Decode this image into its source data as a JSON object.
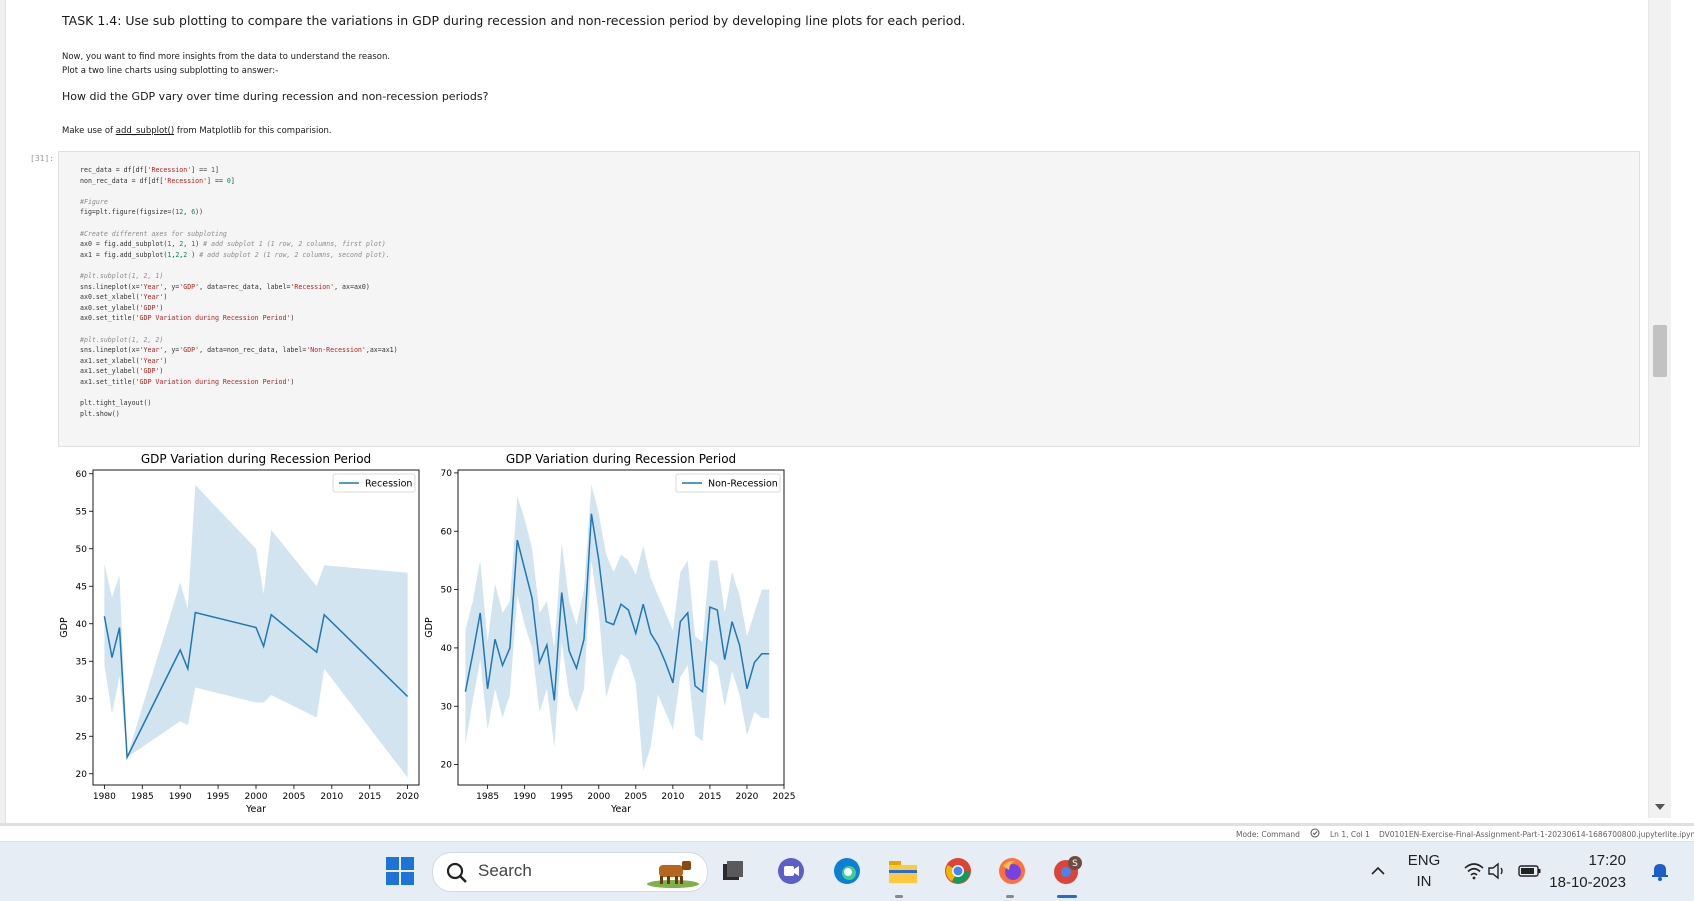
{
  "notebook": {
    "task_heading": "TASK 1.4: Use sub plotting to compare the variations in GDP during recession and non-recession period by developing line plots for each period.",
    "sub_text_1": "Now, you want to find more insights from the data to understand the reason.",
    "sub_text_2": "Plot a two line charts using subplotting to answer:-",
    "question": "How did the GDP vary over time during recession and non-recession periods?",
    "use_prefix": "Make use of ",
    "use_link": "add_subplot()",
    "use_suffix": " from Matplotlib for this comparision.",
    "cell_prompt": "[31]:",
    "code_lines": [
      "rec_data = df[df['Recession'] == 1]",
      "non_rec_data = df[df['Recession'] == 0]",
      "",
      "#Figure",
      "fig=plt.figure(figsize=(12, 6))",
      "",
      "#Create different axes for subploting",
      "ax0 = fig.add_subplot(1, 2, 1) # add subplot 1 (1 row, 2 columns, first plot)",
      "ax1 = fig.add_subplot(1,2,2 ) # add subplot 2 (1 row, 2 columns, second plot).",
      "",
      "#plt.subplot(1, 2, 1)",
      "sns.lineplot(x='Year', y='GDP', data=rec_data, label='Recession', ax=ax0)",
      "ax0.set_xlabel('Year')",
      "ax0.set_ylabel('GDP')",
      "ax0.set_title('GDP Variation during Recession Period')",
      "",
      "#plt.subplot(1, 2, 2)",
      "sns.lineplot(x='Year', y='GDP', data=non_rec_data, label='Non-Recession',ax=ax1)",
      "ax1.set_xlabel('Year')",
      "ax1.set_ylabel('GDP')",
      "ax1.set_title('GDP Variation during Recession Period')",
      "",
      "plt.tight_layout()",
      "plt.show()"
    ]
  },
  "chart_data": [
    {
      "type": "line",
      "title": "GDP Variation during Recession Period",
      "xlabel": "Year",
      "ylabel": "GDP",
      "xlim": [
        1978.5,
        2021.5
      ],
      "ylim": [
        18.5,
        60.5
      ],
      "xticks": [
        1980,
        1985,
        1990,
        1995,
        2000,
        2005,
        2010,
        2015,
        2020
      ],
      "yticks": [
        20,
        25,
        30,
        35,
        40,
        45,
        50,
        55,
        60
      ],
      "legend": "top-right",
      "series": [
        {
          "name": "Recession",
          "color": "#1f77b4",
          "x": [
            1980,
            1981,
            1982,
            1983,
            1990,
            1991,
            1992,
            2000,
            2001,
            2002,
            2008,
            2009,
            2020
          ],
          "y": [
            41.0,
            35.5,
            39.5,
            22.2,
            36.5,
            34.0,
            41.5,
            39.5,
            37.0,
            41.2,
            36.2,
            41.2,
            30.3
          ],
          "ci_low": [
            34.5,
            28.0,
            33.0,
            22.2,
            27.0,
            26.5,
            31.5,
            29.5,
            29.5,
            30.5,
            27.5,
            34.0,
            19.5
          ],
          "ci_high": [
            48.0,
            43.5,
            46.5,
            22.2,
            45.5,
            42.0,
            58.5,
            50.0,
            44.0,
            52.5,
            45.0,
            47.8,
            46.8
          ]
        }
      ]
    },
    {
      "type": "line",
      "title": "GDP Variation during Recession Period",
      "xlabel": "Year",
      "ylabel": "GDP",
      "xlim": [
        1981,
        2025
      ],
      "ylim": [
        16.5,
        70.5
      ],
      "xticks": [
        1985,
        1990,
        1995,
        2000,
        2005,
        2010,
        2015,
        2020,
        2025
      ],
      "yticks": [
        20,
        30,
        40,
        50,
        60,
        70
      ],
      "legend": "top-right",
      "series": [
        {
          "name": "Non-Recession",
          "color": "#1f77b4",
          "x": [
            1982,
            1983,
            1984,
            1985,
            1986,
            1987,
            1988,
            1989,
            1990,
            1991,
            1992,
            1993,
            1994,
            1995,
            1996,
            1997,
            1998,
            1999,
            2000,
            2001,
            2002,
            2003,
            2004,
            2005,
            2006,
            2007,
            2008,
            2009,
            2010,
            2011,
            2012,
            2013,
            2014,
            2015,
            2016,
            2017,
            2018,
            2019,
            2020,
            2021,
            2022,
            2023
          ],
          "y": [
            32.5,
            39.0,
            46.0,
            33.0,
            41.5,
            37.0,
            40.0,
            58.5,
            53.5,
            48.5,
            37.5,
            40.5,
            31.0,
            49.5,
            39.5,
            36.5,
            41.5,
            63.0,
            55.0,
            44.5,
            44.0,
            47.5,
            46.5,
            42.5,
            47.5,
            42.5,
            40.5,
            37.5,
            34.0,
            44.5,
            46.0,
            33.5,
            32.5,
            47.0,
            46.5,
            38.0,
            44.5,
            40.5,
            33.0,
            37.5,
            39.0,
            39.0
          ],
          "ci_low": [
            23.5,
            31.0,
            38.0,
            26.0,
            33.0,
            28.0,
            32.0,
            49.0,
            44.0,
            40.0,
            29.0,
            33.0,
            23.0,
            41.0,
            32.0,
            29.0,
            33.0,
            55.0,
            46.0,
            31.5,
            36.0,
            39.0,
            38.0,
            34.0,
            19.0,
            23.0,
            32.0,
            29.0,
            26.0,
            35.0,
            37.0,
            25.0,
            24.0,
            38.0,
            37.0,
            30.0,
            36.0,
            32.0,
            25.0,
            29.0,
            28.0,
            28.0
          ],
          "ci_high": [
            43.0,
            48.0,
            55.0,
            41.0,
            51.0,
            46.0,
            48.0,
            66.0,
            62.0,
            57.0,
            46.0,
            48.0,
            40.0,
            58.0,
            48.0,
            44.0,
            50.0,
            68.0,
            63.0,
            56.0,
            53.0,
            56.0,
            55.0,
            52.5,
            57.5,
            52.0,
            49.0,
            46.0,
            43.0,
            53.0,
            55.0,
            42.0,
            41.0,
            55.0,
            55.0,
            46.0,
            53.0,
            49.0,
            42.0,
            46.0,
            50.0,
            50.0
          ]
        }
      ]
    }
  ],
  "statusbar": {
    "mode": "Mode: Command",
    "position": "Ln 1, Col 1",
    "filename": "DV0101EN-Exercise-Final-Assignment-Part-1-20230614-1686700800.jupyterlite.ipynb"
  },
  "taskbar": {
    "search_label": "Search",
    "language_top": "ENG",
    "language_bottom": "IN",
    "time": "17:20",
    "date": "18-10-2023"
  }
}
